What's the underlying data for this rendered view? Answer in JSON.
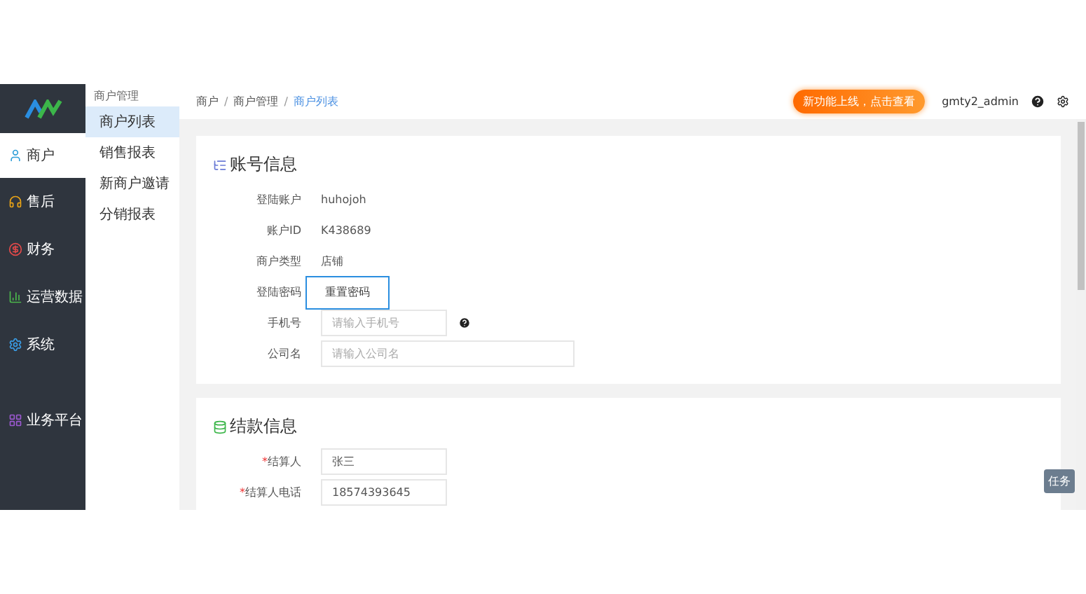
{
  "sidebar": {
    "items": [
      {
        "label": "商户",
        "selected": true,
        "color": "#2e9fd8"
      },
      {
        "label": "售后",
        "selected": false,
        "color": "#e8a317"
      },
      {
        "label": "财务",
        "selected": false,
        "color": "#e24a4a"
      },
      {
        "label": "运营数据",
        "selected": false,
        "color": "#4cb84c"
      },
      {
        "label": "系统",
        "selected": false,
        "color": "#3a9ee8"
      },
      {
        "label": "业务平台",
        "selected": false,
        "color": "#9b59d0"
      }
    ]
  },
  "submenu": {
    "title": "商户管理",
    "items": [
      {
        "label": "商户列表",
        "selected": true
      },
      {
        "label": "销售报表",
        "selected": false
      },
      {
        "label": "新商户邀请",
        "selected": false
      },
      {
        "label": "分销报表",
        "selected": false
      }
    ]
  },
  "breadcrumb": [
    {
      "label": "商户",
      "selected": false,
      "separator": "/"
    },
    {
      "label": "商户管理",
      "selected": false,
      "separator": "/"
    },
    {
      "label": "商户列表",
      "selected": true
    }
  ],
  "header": {
    "promo": "新功能上线，点击查看",
    "username": "gmty2_admin"
  },
  "sections": [
    {
      "title": "账号信息",
      "fields": [
        {
          "label": "登陆账户",
          "kind": "text",
          "value": "huhojoh"
        },
        {
          "label": "账户ID",
          "kind": "text",
          "value": "K438689"
        },
        {
          "label": "商户类型",
          "kind": "text",
          "value": "店铺"
        },
        {
          "label": "登陆密码",
          "kind": "button",
          "value": "重置密码"
        },
        {
          "label": "手机号",
          "kind": "input",
          "placeholder": "请输入手机号",
          "help": true,
          "wide": false
        },
        {
          "label": "公司名",
          "kind": "input",
          "placeholder": "请输入公司名",
          "wide": true
        }
      ]
    },
    {
      "title": "结款信息",
      "fields": [
        {
          "label": "结算人",
          "kind": "input",
          "value": "张三",
          "wide": false,
          "asterisk": "*"
        },
        {
          "label": "结算人电话",
          "kind": "input",
          "value": "18574393645",
          "wide": false,
          "asterisk": "*"
        }
      ]
    }
  ],
  "task_button": "任务"
}
